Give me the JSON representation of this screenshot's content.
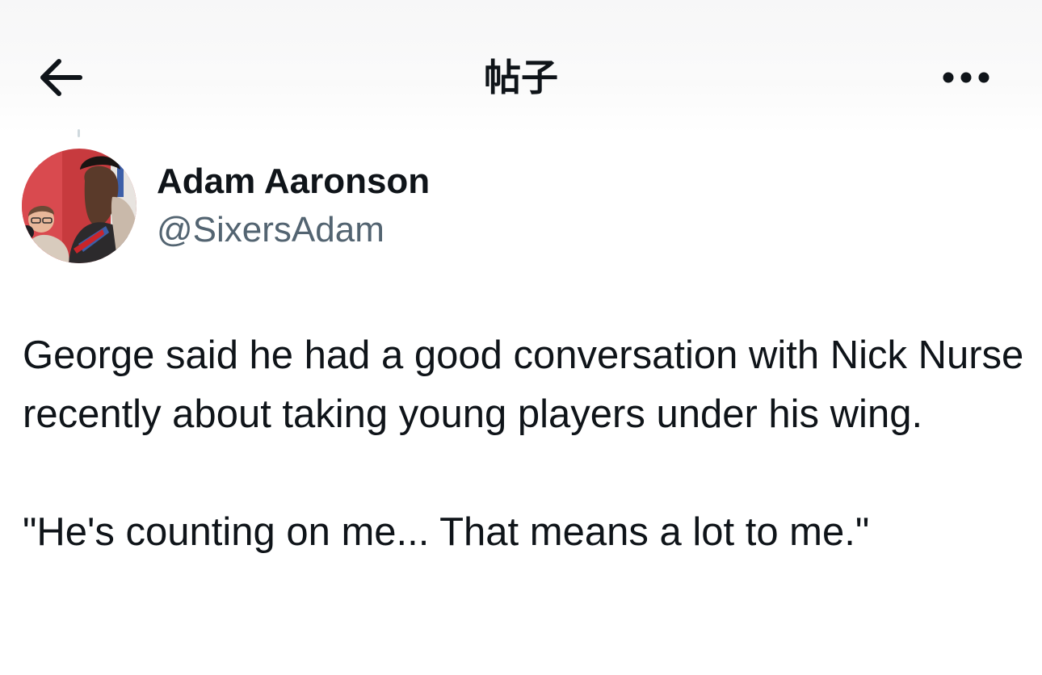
{
  "header": {
    "title": "帖子",
    "back_icon": "arrow-left-icon",
    "more_icon": "more-horizontal-icon"
  },
  "author": {
    "name": "Adam Aaronson",
    "handle": "@SixersAdam",
    "avatar_icon": "profile-photo"
  },
  "tweet": {
    "paragraphs": [
      "George said he had a good conversation with Nick Nurse recently about taking young players under his wing.",
      "\"He's counting on me... That means a lot to me.\""
    ]
  },
  "colors": {
    "text_primary": "#0f1419",
    "text_secondary": "#536471",
    "background": "#ffffff"
  }
}
